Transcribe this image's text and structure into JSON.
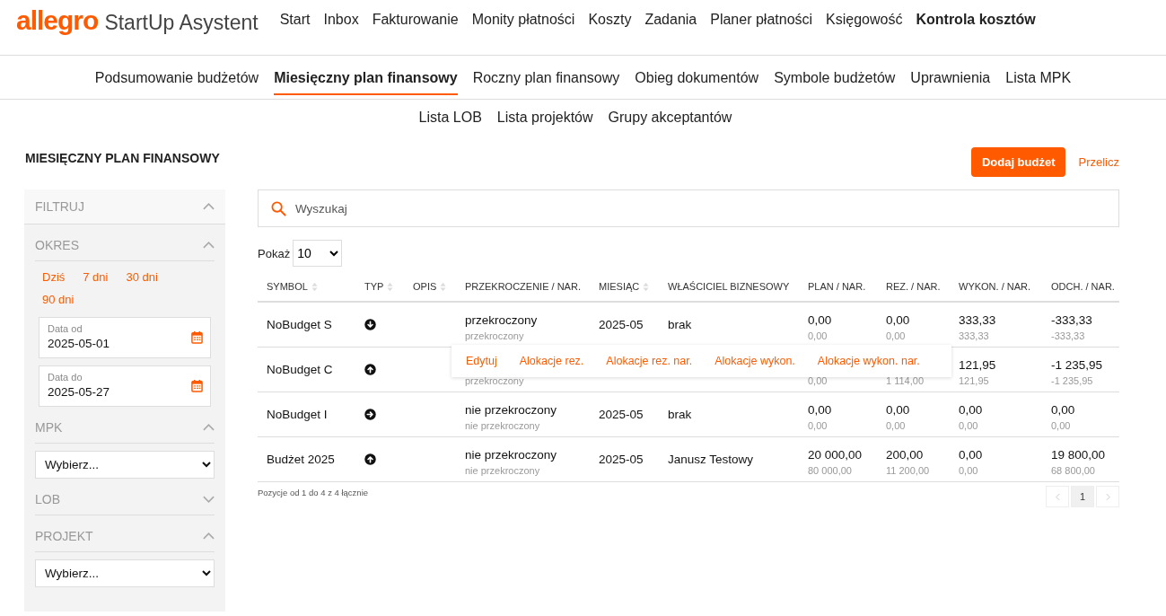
{
  "brand": {
    "logo": "allegro",
    "product": "StartUp Asystent"
  },
  "main_nav": [
    {
      "label": "Start",
      "selected": false
    },
    {
      "label": "Inbox",
      "selected": false
    },
    {
      "label": "Fakturowanie",
      "selected": false
    },
    {
      "label": "Monity płatności",
      "selected": false
    },
    {
      "label": "Koszty",
      "selected": false
    },
    {
      "label": "Zadania",
      "selected": false
    },
    {
      "label": "Planer płatności",
      "selected": false
    },
    {
      "label": "Księgowość",
      "selected": false
    },
    {
      "label": "Kontrola kosztów",
      "selected": true
    }
  ],
  "sub_nav": [
    {
      "label": "Podsumowanie budżetów",
      "selected": false
    },
    {
      "label": "Miesięczny plan finansowy",
      "selected": true
    },
    {
      "label": "Roczny plan finansowy",
      "selected": false
    },
    {
      "label": "Obieg dokumentów",
      "selected": false
    },
    {
      "label": "Symbole budżetów",
      "selected": false
    },
    {
      "label": "Uprawnienia",
      "selected": false
    },
    {
      "label": "Lista MPK",
      "selected": false
    },
    {
      "label": "Lista LOB",
      "selected": false
    },
    {
      "label": "Lista projektów",
      "selected": false
    },
    {
      "label": "Grupy akceptantów",
      "selected": false
    }
  ],
  "page_title": "MIESIĘCZNY PLAN FINANSOWY",
  "actions": {
    "primary": "Dodaj budżet",
    "secondary": "Przelicz"
  },
  "filters": {
    "title": "FILTRUJ",
    "expanded": true,
    "sections": [
      {
        "kind": "period",
        "title": "OKRES",
        "expanded": true,
        "quick": [
          "Dziś",
          "7 dni",
          "30 dni",
          "90 dni"
        ],
        "dates": [
          {
            "label": "Data od",
            "value": "2025-05-01"
          },
          {
            "label": "Data do",
            "value": "2025-05-27"
          }
        ]
      },
      {
        "kind": "select",
        "title": "MPK",
        "expanded": true,
        "value": "Wybierz..."
      },
      {
        "title": "LOB",
        "expanded": false
      },
      {
        "kind": "select",
        "title": "PROJEKT",
        "expanded": true,
        "value": "Wybierz..."
      }
    ]
  },
  "search": {
    "placeholder": "Wyszukaj"
  },
  "page_size": {
    "label": "Pokaż",
    "value": "10"
  },
  "table": {
    "columns": [
      {
        "label": "SYMBOL",
        "sortable": true
      },
      {
        "label": "TYP",
        "sortable": true
      },
      {
        "label": "OPIS",
        "sortable": true
      },
      {
        "label": "PRZEKROCZENIE / NAR.",
        "sortable": false
      },
      {
        "label": "MIESIĄC",
        "sortable": true
      },
      {
        "label": "WŁAŚCICIEL BIZNESOWY",
        "sortable": false
      },
      {
        "label": "PLAN / NAR.",
        "sortable": false
      },
      {
        "label": "REZ. / NAR.",
        "sortable": false
      },
      {
        "label": "WYKON. / NAR.",
        "sortable": false
      },
      {
        "label": "ODCH. / NAR.",
        "sortable": false
      }
    ],
    "rows": [
      {
        "symbol": "NoBudget S",
        "kind": "down",
        "exceeded": {
          "main": "przekroczony",
          "sub": "przekroczony"
        },
        "month": "2025-05",
        "owner": "brak",
        "plan": {
          "main": "0,00",
          "sub": "0,00"
        },
        "rez": {
          "main": "0,00",
          "sub": "0,00"
        },
        "wykon": {
          "main": "333,33",
          "sub": "333,33"
        },
        "odch": {
          "main": "-333,33",
          "sub": "-333,33"
        }
      },
      {
        "symbol": "NoBudget C",
        "kind": "up",
        "exceeded": {
          "sub": "przekroczony"
        },
        "plan": {
          "sub": "0,00"
        },
        "rez": {
          "sub": "1 114,00"
        },
        "wykon": {
          "main": "121,95",
          "sub": "121,95"
        },
        "odch": {
          "main": "-1 235,95",
          "sub": "-1 235,95"
        },
        "menu": [
          "Edytuj",
          "Alokacje rez.",
          "Alokacje rez. nar.",
          "Alokacje wykon.",
          "Alokacje wykon. nar."
        ]
      },
      {
        "symbol": "NoBudget I",
        "kind": "right",
        "exceeded": {
          "main": "nie przekroczony",
          "sub": "nie przekroczony"
        },
        "month": "2025-05",
        "owner": "brak",
        "plan": {
          "main": "0,00",
          "sub": "0,00"
        },
        "rez": {
          "main": "0,00",
          "sub": "0,00"
        },
        "wykon": {
          "main": "0,00",
          "sub": "0,00"
        },
        "odch": {
          "main": "0,00",
          "sub": "0,00"
        }
      },
      {
        "symbol": "Budżet 2025",
        "kind": "up",
        "exceeded": {
          "main": "nie przekroczony",
          "sub": "nie przekroczony"
        },
        "month": "2025-05",
        "owner": "Janusz Testowy",
        "plan": {
          "main": "20 000,00",
          "sub": "80 000,00"
        },
        "rez": {
          "main": "200,00",
          "sub": "11 200,00"
        },
        "wykon": {
          "main": "0,00",
          "sub": "0,00"
        },
        "odch": {
          "main": "19 800,00",
          "sub": "68 800,00"
        }
      }
    ]
  },
  "info": "Pozycje od 1 do 4 z 4 łącznie",
  "pagination": {
    "prev_disabled": true,
    "next_disabled": true,
    "pages": [
      {
        "label": "1",
        "selected": true
      }
    ]
  }
}
